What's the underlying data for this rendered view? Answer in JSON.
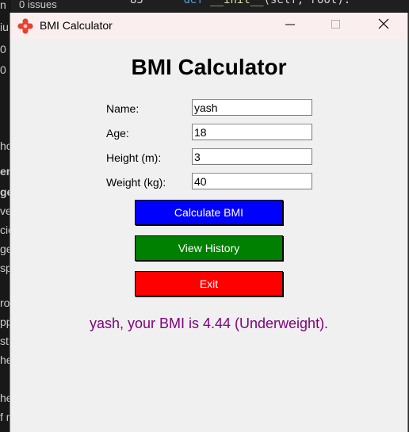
{
  "background": {
    "issues_text": "0 issues",
    "code_fragment": "def __init__(self, root):",
    "left_fragments": [
      "n",
      "iu",
      "0",
      "0",
      "ho",
      "er",
      "ge",
      "ve",
      "cio",
      "ge",
      "sp",
      "rov",
      "pp",
      "st",
      "he",
      "he",
      "f n"
    ]
  },
  "window": {
    "title": "BMI Calculator",
    "icon": "bmi-app-icon",
    "controls": [
      "minimize-icon",
      "maximize-icon",
      "close-icon"
    ]
  },
  "app": {
    "heading": "BMI Calculator",
    "fields": {
      "name": {
        "label": "Name:",
        "value": "yash"
      },
      "age": {
        "label": "Age:",
        "value": "18"
      },
      "height": {
        "label": "Height (m):",
        "value": "3"
      },
      "weight": {
        "label": "Weight (kg):",
        "value": "40"
      }
    },
    "buttons": {
      "calculate": "Calculate BMI",
      "history": "View History",
      "exit": "Exit"
    },
    "result": "yash, your BMI is 4.44 (Underweight)."
  },
  "colors": {
    "calculate_bg": "#0000ff",
    "history_bg": "#008000",
    "exit_bg": "#ff0000",
    "result_text": "#800080",
    "window_bg": "#f0f0f0",
    "titlebar_bg": "#fbeeee"
  }
}
